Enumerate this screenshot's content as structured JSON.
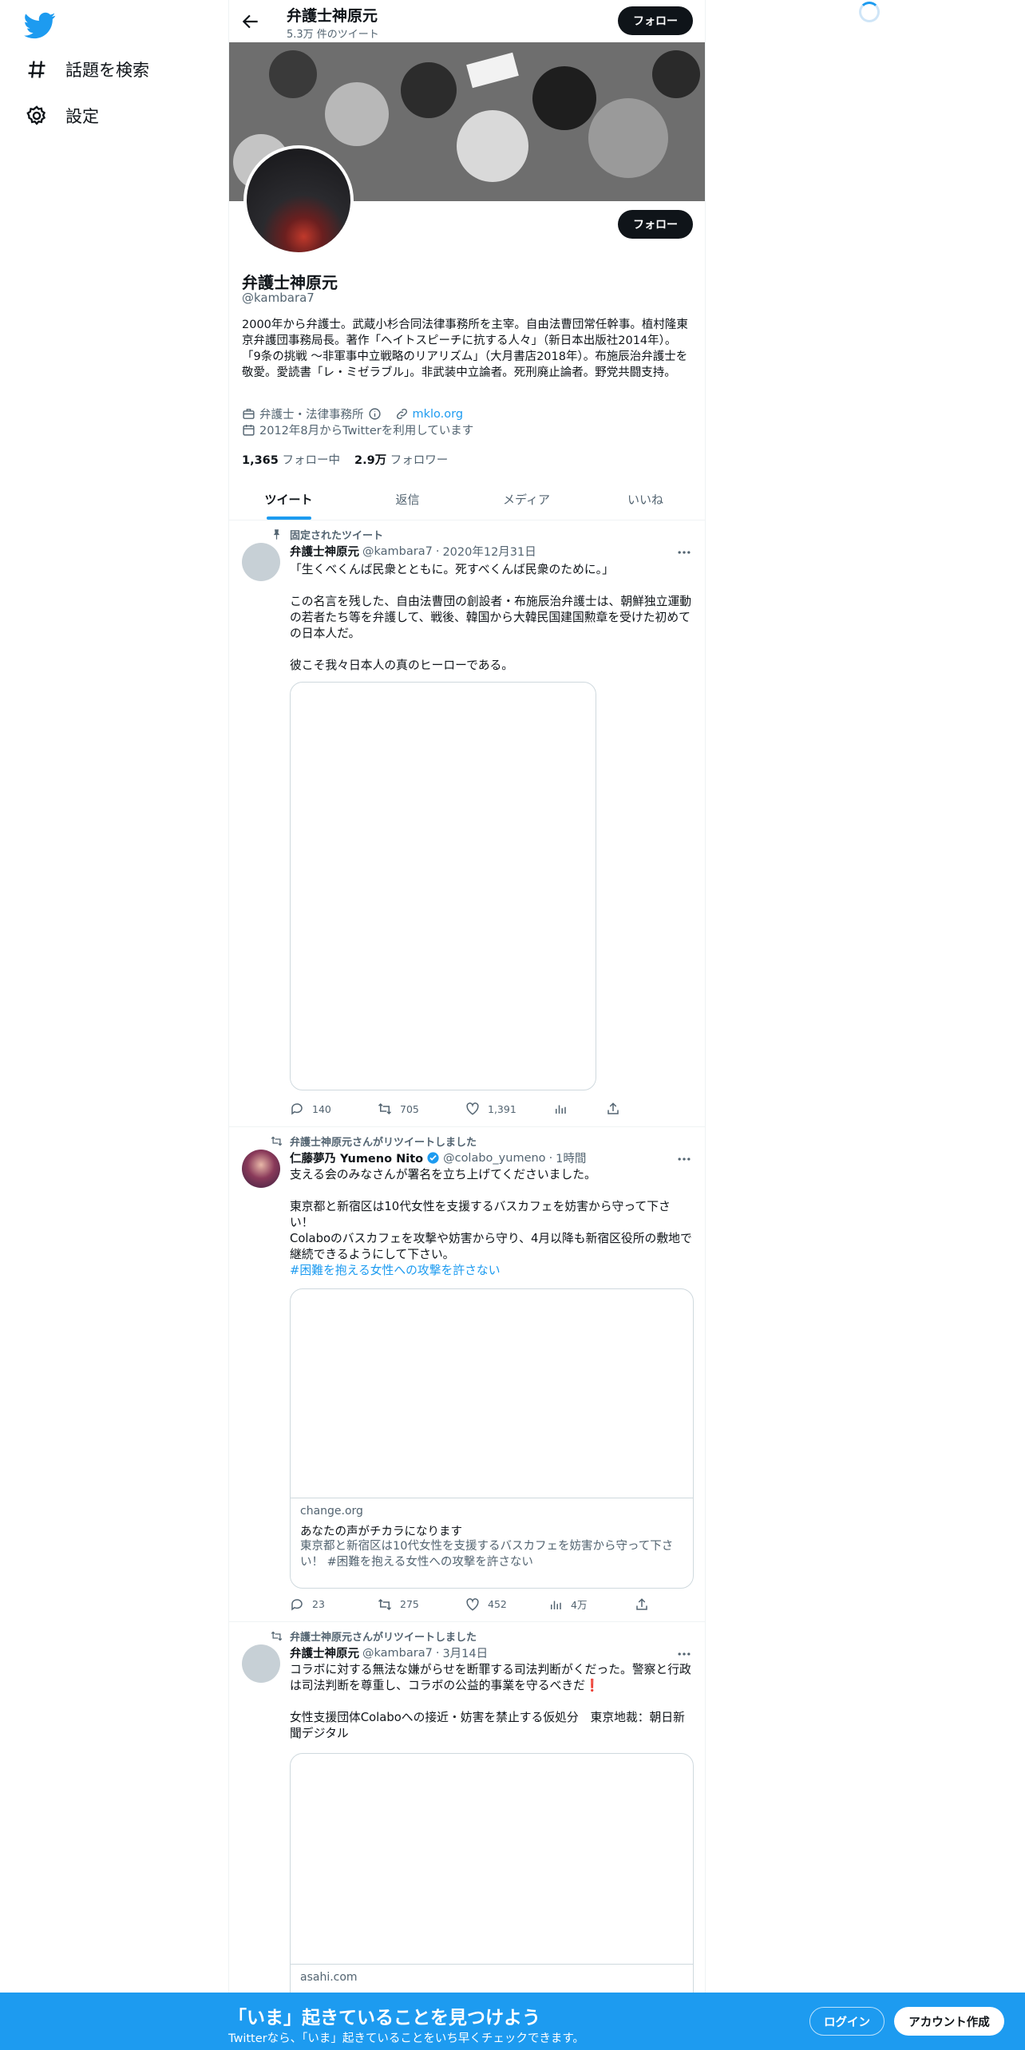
{
  "nav": {
    "items": [
      {
        "label": "話題を検索",
        "icon": "hashtag-icon"
      },
      {
        "label": "設定",
        "icon": "gear-icon"
      }
    ]
  },
  "header": {
    "title": "弁護士神原元",
    "tweet_count": "5.3万 件のツイート",
    "follow_label": "フォロー"
  },
  "profile": {
    "follow_label": "フォロー",
    "name": "弁護士神原元",
    "handle": "@kambara7",
    "bio": "2000年から弁護士。武蔵小杉合同法律事務所を主宰。自由法曹団常任幹事。植村隆東京弁護団事務局長。著作「ヘイトスピーチに抗する人々」（新日本出版社2014年）。「9条の挑戦 ～非軍事中立戦略のリアリズム」（大月書店2018年）。布施辰治弁護士を敬愛。愛読書「レ・ミゼラブル」。非武装中立論者。死刑廃止論者。野党共闘支持。",
    "category": "弁護士・法律事務所",
    "website": "mklo.org",
    "joined": "2012年8月からTwitterを利用しています",
    "following_count": "1,365",
    "following_label": "フォロー中",
    "followers_count": "2.9万",
    "followers_label": "フォロワー"
  },
  "tabs": [
    {
      "label": "ツイート",
      "active": true
    },
    {
      "label": "返信"
    },
    {
      "label": "メディア"
    },
    {
      "label": "いいね"
    }
  ],
  "tweets": [
    {
      "context": "固定されたツイート",
      "name": "弁護士神原元",
      "handle": "@kambara7",
      "date": "2020年12月31日",
      "text": "「生くべくんば民衆とともに。死すべくんば民衆のために。」\n\nこの名言を残した、自由法曹団の創設者・布施辰治弁護士は、朝鮮独立運動の若者たち等を弁護して、戦後、韓国から大韓民国建国勲章を受けた初めての日本人だ。\n\n彼こそ我々日本人の真のヒーローである。",
      "replies": "140",
      "retweets": "705",
      "likes": "1,391"
    },
    {
      "context": "弁護士神原元さんがリツイートしました",
      "name": "仁藤夢乃 Yumeno Nito",
      "handle": "@colabo_yumeno",
      "date": "1時間",
      "text": "支える会のみなさんが署名を立ち上げてくださいました。\n\n東京都と新宿区は10代女性を支援するバスカフェを妨害から守って下さい！\nColaboのバスカフェを攻撃や妨害から守り、4月以降も新宿区役所の敷地で継続できるようにして下さい。",
      "hashtag": "#困難を抱える女性への攻撃を許さない",
      "card_domain": "change.org",
      "card_title": "あなたの声がチカラになります",
      "card_desc": "東京都と新宿区は10代女性を支援するバスカフェを妨害から守って下さい！ #困難を抱える女性への攻撃を許さない",
      "replies": "23",
      "retweets": "275",
      "likes": "452",
      "views": "4万"
    },
    {
      "context": "弁護士神原元さんがリツイートしました",
      "name": "弁護士神原元",
      "handle": "@kambara7",
      "date": "3月14日",
      "text": "コラボに対する無法な嫌がらせを断罪する司法判断がくだった。警察と行政は司法判断を尊重し、コラボの公益的事業を守るべきだ❗\n\n女性支援団体Colaboへの接近・妨害を禁止する仮処分　東京地裁：朝日新聞デジタル",
      "card_domain": "asahi.com"
    }
  ],
  "bottom_bar": {
    "title": "「いま」起きていることを見つけよう",
    "subtitle": "Twitterなら、「いま」起きていることをいち早くチェックできます。",
    "login_label": "ログイン",
    "signup_label": "アカウント作成"
  },
  "colors": {
    "accent": "#1d9bf0",
    "text": "#0f1419",
    "secondary": "#536471"
  }
}
